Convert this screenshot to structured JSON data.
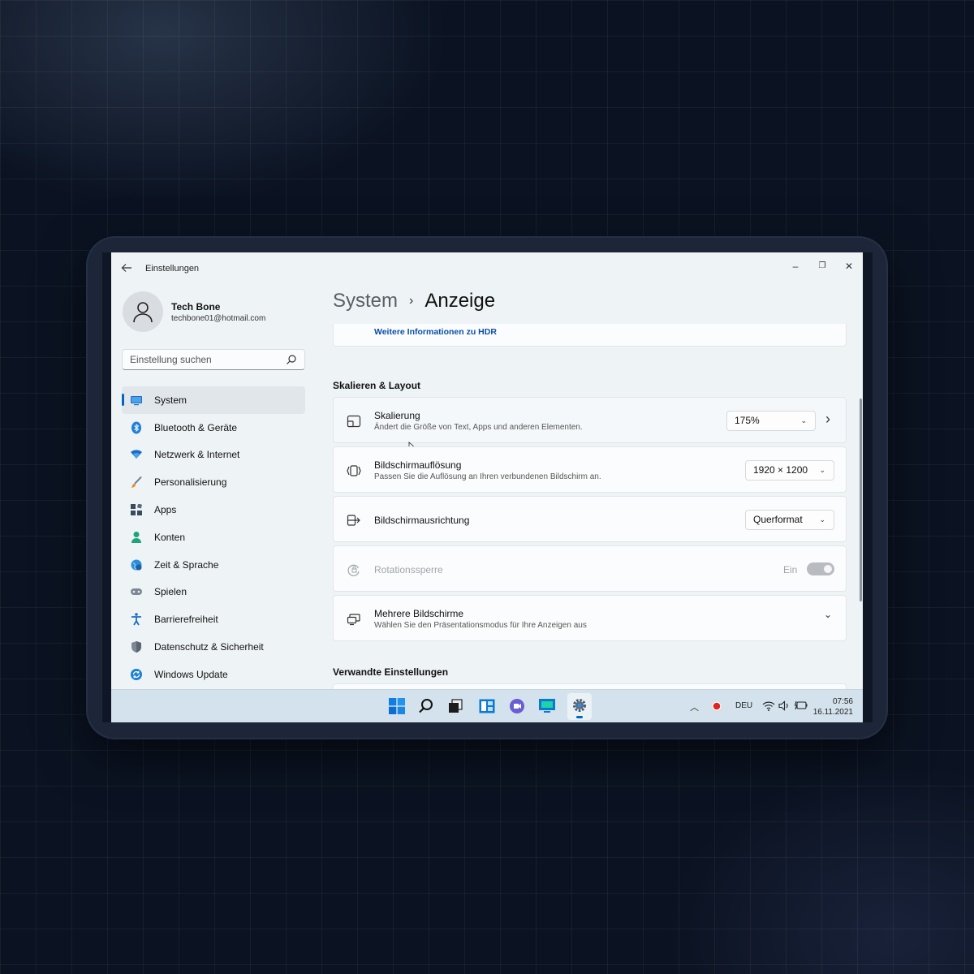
{
  "window": {
    "title": "Einstellungen",
    "minimize": "–",
    "maximize": "❐",
    "close": "✕"
  },
  "user": {
    "name": "Tech Bone",
    "email": "techbone01@hotmail.com"
  },
  "search": {
    "placeholder": "Einstellung suchen"
  },
  "sidebar": {
    "items": [
      {
        "label": "System",
        "icon": "monitor-icon",
        "active": true
      },
      {
        "label": "Bluetooth & Geräte",
        "icon": "bluetooth-icon"
      },
      {
        "label": "Netzwerk & Internet",
        "icon": "wifi-icon"
      },
      {
        "label": "Personalisierung",
        "icon": "brush-icon"
      },
      {
        "label": "Apps",
        "icon": "apps-icon"
      },
      {
        "label": "Konten",
        "icon": "person-icon"
      },
      {
        "label": "Zeit & Sprache",
        "icon": "globe-clock-icon"
      },
      {
        "label": "Spielen",
        "icon": "gamepad-icon"
      },
      {
        "label": "Barrierefreiheit",
        "icon": "accessibility-icon"
      },
      {
        "label": "Datenschutz & Sicherheit",
        "icon": "shield-icon"
      },
      {
        "label": "Windows Update",
        "icon": "update-icon"
      }
    ]
  },
  "breadcrumb": {
    "parent": "System",
    "separator": "›",
    "current": "Anzeige"
  },
  "main": {
    "hdr_link": "Weitere Informationen zu HDR",
    "section_scaling": "Skalieren & Layout",
    "rows": {
      "scaling": {
        "title": "Skalierung",
        "subtitle": "Ändert die Größe von Text, Apps und anderen Elementen.",
        "value": "175%"
      },
      "resolution": {
        "title": "Bildschirmauflösung",
        "subtitle": "Passen Sie die Auflösung an Ihren verbundenen Bildschirm an.",
        "value": "1920 × 1200"
      },
      "orientation": {
        "title": "Bildschirmausrichtung",
        "value": "Querformat"
      },
      "rotation_lock": {
        "title": "Rotationssperre",
        "state": "Ein"
      },
      "multiple": {
        "title": "Mehrere Bildschirme",
        "subtitle": "Wählen Sie den Präsentationsmodus für Ihre Anzeigen aus"
      }
    },
    "section_related": "Verwandte Einstellungen"
  },
  "taskbar": {
    "language": "DEU",
    "time": "07:56",
    "date": "16.11.2021"
  },
  "colors": {
    "accent": "#0067c0",
    "record": "#e02424"
  }
}
